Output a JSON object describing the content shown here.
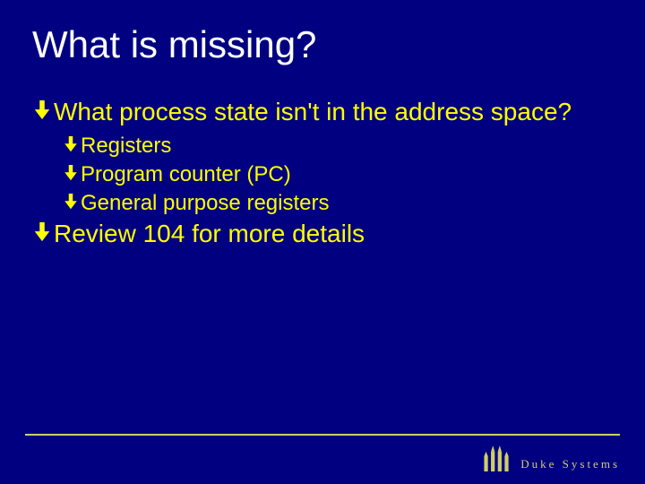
{
  "title": "What is missing?",
  "bullets": {
    "b0": "What process state isn't in the address space?",
    "b0_children": {
      "c0": "Registers",
      "c1": "Program counter (PC)",
      "c2": "General purpose registers"
    },
    "b1": "Review 104 for more details"
  },
  "brand": "Duke Systems"
}
